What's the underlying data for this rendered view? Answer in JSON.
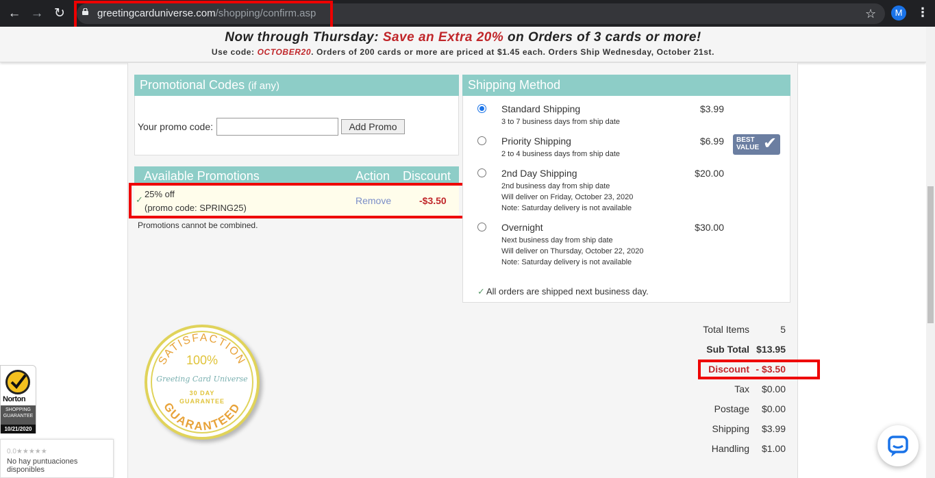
{
  "browser": {
    "url_domain": "greetingcarduniverse.com",
    "url_path": "/shopping/confirm.asp",
    "avatar_letter": "M"
  },
  "banner": {
    "line1_prefix": "Now through Thursday: ",
    "line1_highlight": "Save an Extra 20%",
    "line1_suffix": " on Orders of 3 cards or more!",
    "line2_prefix": "Use code: ",
    "line2_code": "OCTOBER20",
    "line2_suffix": ".  Orders of 200 cards or more are priced at $1.45 each.  Orders Ship Wednesday, October 21st."
  },
  "promo_codes": {
    "title": "Promotional Codes",
    "title_hint": "(if any)",
    "input_label": "Your promo code:",
    "input_value": "",
    "add_button": "Add Promo"
  },
  "available_promotions": {
    "header_title": "Available Promotions",
    "header_action": "Action",
    "header_discount": "Discount",
    "items": [
      {
        "name": "25% off",
        "code_line": "(promo code: SPRING25)",
        "action": "Remove",
        "discount": "-$3.50"
      }
    ],
    "note": "Promotions cannot be combined."
  },
  "shipping": {
    "title": "Shipping Method",
    "options": [
      {
        "name": "Standard Shipping",
        "price": "$3.99",
        "details": [
          "3 to 7 business days from ship date"
        ],
        "selected": true
      },
      {
        "name": "Priority Shipping",
        "price": "$6.99",
        "details": [
          "2 to 4 business days from ship date"
        ],
        "selected": false
      },
      {
        "name": "2nd Day Shipping",
        "price": "$20.00",
        "details": [
          "2nd business day from ship date",
          "Will deliver on Friday, October 23, 2020",
          "Note: Saturday delivery is not available"
        ],
        "selected": false
      },
      {
        "name": "Overnight",
        "price": "$30.00",
        "details": [
          "Next business day from ship date",
          "Will deliver on Thursday, October 22, 2020",
          "Note: Saturday delivery is not available"
        ],
        "selected": false
      }
    ],
    "best_value_line1": "BEST",
    "best_value_line2": "VALUE",
    "note": "All orders are shipped next business day."
  },
  "summary": {
    "total_items_label": "Total Items",
    "total_items_value": "5",
    "subtotal_label": "Sub Total",
    "subtotal_value": "$13.95",
    "discount_label": "Discount",
    "discount_value": "- $3.50",
    "tax_label": "Tax",
    "tax_value": "$0.00",
    "postage_label": "Postage",
    "postage_value": "$0.00",
    "shipping_label": "Shipping",
    "shipping_value": "$3.99",
    "handling_label": "Handling",
    "handling_value": "$1.00"
  },
  "seal": {
    "top_text": "SATISFACTION",
    "percent": "100%",
    "brand": "Greeting Card Universe",
    "days": "30 DAY",
    "guarantee": "GUARANTEE",
    "bottom_text": "GUARANTEED"
  },
  "norton": {
    "name": "Norton",
    "line1": "SHOPPING",
    "line2": "GUARANTEE",
    "date": "10/21/2020"
  },
  "rating": {
    "score": "0.0",
    "stars": "★★★★★",
    "text": "No hay puntuaciones disponibles"
  },
  "colors": {
    "teal_header": "#8dcdc7",
    "discount_red": "#c0262a",
    "highlight_red": "#ee0000",
    "link_blue": "#7b8ec8"
  }
}
